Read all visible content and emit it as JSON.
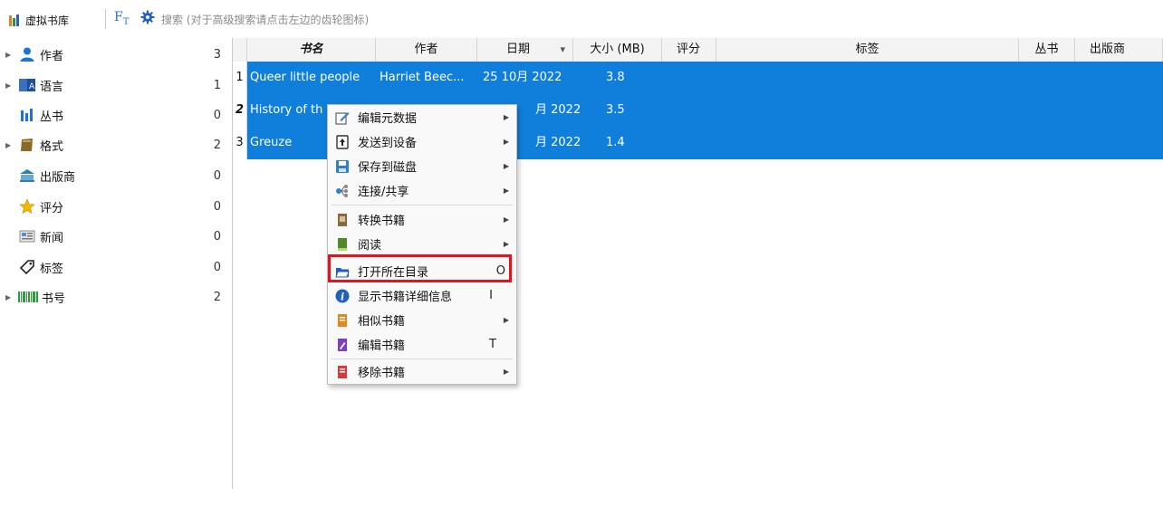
{
  "toolbar": {
    "virtual_library": "虚拟书库",
    "search_placeholder": "搜索 (对于高级搜索请点击左边的齿轮图标)",
    "ft_label": "F",
    "ft_sub": "T"
  },
  "sidebar": {
    "items": [
      {
        "label": "作者",
        "count": "3",
        "icon": "person-icon",
        "expandable": true
      },
      {
        "label": "语言",
        "count": "1",
        "icon": "language-icon",
        "expandable": true
      },
      {
        "label": "丛书",
        "count": "0",
        "icon": "series-icon",
        "expandable": false
      },
      {
        "label": "格式",
        "count": "2",
        "icon": "format-icon",
        "expandable": true
      },
      {
        "label": "出版商",
        "count": "0",
        "icon": "publisher-icon",
        "expandable": false
      },
      {
        "label": "评分",
        "count": "0",
        "icon": "star-icon",
        "expandable": false
      },
      {
        "label": "新闻",
        "count": "0",
        "icon": "news-icon",
        "expandable": false
      },
      {
        "label": "标签",
        "count": "0",
        "icon": "tag-icon",
        "expandable": false
      },
      {
        "label": "书号",
        "count": "2",
        "icon": "barcode-icon",
        "expandable": true
      }
    ]
  },
  "table": {
    "headers": [
      "书名",
      "作者",
      "日期",
      "大小 (MB)",
      "评分",
      "标签",
      "丛书",
      "出版商"
    ],
    "sort_arrow": "▾",
    "rows": [
      {
        "num": "1",
        "title": "Queer little people",
        "author": "Harriet Beec...",
        "date": "25 10月 2022",
        "size": "3.8"
      },
      {
        "num": "2",
        "title": "History of th",
        "author": "",
        "date": "月 2022",
        "size": "3.5"
      },
      {
        "num": "3",
        "title": "Greuze",
        "author": "",
        "date": "月 2022",
        "size": "1.4"
      }
    ]
  },
  "context_menu": {
    "items": [
      {
        "label": "编辑元数据",
        "icon": "edit-metadata-icon",
        "submenu": true,
        "shortcut": ""
      },
      {
        "label": "发送到设备",
        "icon": "send-device-icon",
        "submenu": true,
        "shortcut": ""
      },
      {
        "label": "保存到磁盘",
        "icon": "save-disk-icon",
        "submenu": true,
        "shortcut": ""
      },
      {
        "label": "连接/共享",
        "icon": "connect-share-icon",
        "submenu": true,
        "shortcut": ""
      },
      {
        "label": "转换书籍",
        "icon": "convert-book-icon",
        "submenu": true,
        "shortcut": ""
      },
      {
        "label": "阅读",
        "icon": "read-icon",
        "submenu": true,
        "shortcut": ""
      },
      {
        "label": "打开所在目录",
        "icon": "open-folder-icon",
        "submenu": false,
        "shortcut": "O"
      },
      {
        "label": "显示书籍详细信息",
        "icon": "info-icon",
        "submenu": false,
        "shortcut": "I"
      },
      {
        "label": "相似书籍",
        "icon": "similar-books-icon",
        "submenu": true,
        "shortcut": ""
      },
      {
        "label": "编辑书籍",
        "icon": "edit-book-icon",
        "submenu": false,
        "shortcut": "T"
      },
      {
        "label": "移除书籍",
        "icon": "remove-book-icon",
        "submenu": true,
        "shortcut": ""
      }
    ]
  },
  "colors": {
    "selection": "#0f7fdb",
    "highlight_box": "#e3141b"
  }
}
